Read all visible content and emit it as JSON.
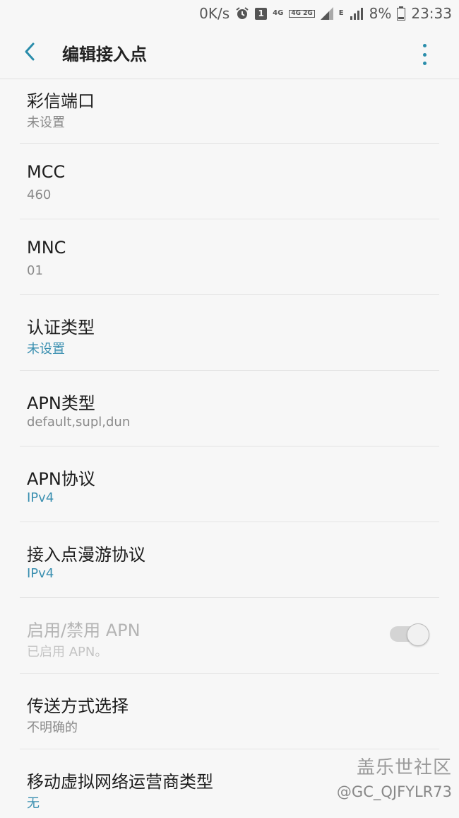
{
  "status_bar": {
    "speed": "0K/s",
    "sim": "1",
    "net_4g": "4G",
    "net_stack": "4G 2G",
    "net_e": "E",
    "battery": "8%",
    "time": "23:33"
  },
  "app_bar": {
    "title": "编辑接入点"
  },
  "rows": [
    {
      "title": "彩信端口",
      "sub": "未设置"
    },
    {
      "title": "MCC",
      "sub": "460"
    },
    {
      "title": "MNC",
      "sub": "01"
    },
    {
      "title": "认证类型",
      "sub": "未设置"
    },
    {
      "title": "APN类型",
      "sub": "default,supl,dun"
    },
    {
      "title": "APN协议",
      "sub": "IPv4"
    },
    {
      "title": "接入点漫游协议",
      "sub": "IPv4"
    },
    {
      "title": "启用/禁用 APN",
      "sub": "已启用 APN。",
      "toggle_on": true
    },
    {
      "title": "传送方式选择",
      "sub": "不明确的"
    },
    {
      "title": "移动虚拟网络运营商类型",
      "sub": "无"
    }
  ],
  "watermark": {
    "logo": "盖乐世社区",
    "user": "@GC_QJFYLR73"
  },
  "colors": {
    "accent": "#3a8fb0",
    "background": "#f7f7f7"
  }
}
